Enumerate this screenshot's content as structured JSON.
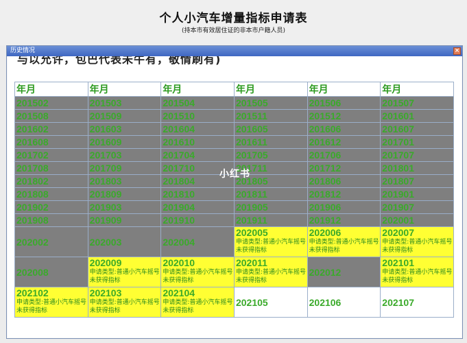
{
  "header": {
    "title": "个人小汽车增量指标申请表",
    "subtitle": "(持本市有效居住证的非本市户籍人员)"
  },
  "window": {
    "title": "历史情况",
    "close_glyph": "×",
    "clipped_text": "与以允许，包巴代表未牛有，敬情刷有)"
  },
  "table": {
    "header": [
      "年月",
      "年月",
      "年月",
      "年月",
      "年月",
      "年月"
    ],
    "grey_rows": [
      [
        "201502",
        "201503",
        "201504",
        "201505",
        "201506",
        "201507"
      ],
      [
        "201508",
        "201509",
        "201510",
        "201511",
        "201512",
        "201601"
      ],
      [
        "201602",
        "201603",
        "201604",
        "201605",
        "201606",
        "201607"
      ],
      [
        "201608",
        "201609",
        "201610",
        "201611",
        "201612",
        "201701"
      ],
      [
        "201702",
        "201703",
        "201704",
        "201705",
        "201706",
        "201707"
      ],
      [
        "201708",
        "201709",
        "201710",
        "201711",
        "201712",
        "201801"
      ],
      [
        "201802",
        "201803",
        "201804",
        "201805",
        "201806",
        "201807"
      ],
      [
        "201808",
        "201809",
        "201810",
        "201811",
        "201812",
        "201901"
      ],
      [
        "201902",
        "201903",
        "201904",
        "201905",
        "201906",
        "201907"
      ],
      [
        "201908",
        "201909",
        "201910",
        "201911",
        "201912",
        "202001"
      ]
    ],
    "tall_rows": [
      [
        {
          "month": "202002",
          "status": "gray",
          "note1": "",
          "note2": ""
        },
        {
          "month": "202003",
          "status": "gray",
          "note1": "",
          "note2": ""
        },
        {
          "month": "202004",
          "status": "gray",
          "note1": "",
          "note2": ""
        },
        {
          "month": "202005",
          "status": "yellow",
          "note1": "申请类型:普通小汽车摇号",
          "note2": "未获得指标"
        },
        {
          "month": "202006",
          "status": "yellow",
          "note1": "申请类型:普通小汽车摇号",
          "note2": "未获得指标"
        },
        {
          "month": "202007",
          "status": "yellow",
          "note1": "申请类型:普通小汽车摇号",
          "note2": "未获得指标"
        }
      ],
      [
        {
          "month": "202008",
          "status": "gray",
          "note1": "",
          "note2": ""
        },
        {
          "month": "202009",
          "status": "yellow",
          "note1": "申请类型:普通小汽车摇号",
          "note2": "未获得指标"
        },
        {
          "month": "202010",
          "status": "yellow",
          "note1": "申请类型:普通小汽车摇号",
          "note2": "未获得指标"
        },
        {
          "month": "202011",
          "status": "yellow",
          "note1": "申请类型:普通小汽车摇号",
          "note2": "未获得指标"
        },
        {
          "month": "202012",
          "status": "gray",
          "note1": "",
          "note2": ""
        },
        {
          "month": "202101",
          "status": "yellow",
          "note1": "申请类型:普通小汽车摇号",
          "note2": "未获得指标"
        }
      ],
      [
        {
          "month": "202102",
          "status": "yellow",
          "note1": "申请类型:普通小汽车摇号",
          "note2": "未获得指标"
        },
        {
          "month": "202103",
          "status": "yellow",
          "note1": "申请类型:普通小汽车摇号",
          "note2": "未获得指标"
        },
        {
          "month": "202104",
          "status": "yellow",
          "note1": "申请类型:普通小汽车摇号",
          "note2": "未获得指标"
        },
        {
          "month": "202105",
          "status": "white",
          "note1": "",
          "note2": ""
        },
        {
          "month": "202106",
          "status": "white",
          "note1": "",
          "note2": ""
        },
        {
          "month": "202107",
          "status": "white",
          "note1": "",
          "note2": ""
        }
      ]
    ]
  },
  "watermark": "小红书",
  "colors": {
    "gray_cell": "#7f7f7f",
    "yellow_cell": "#ffff33",
    "text_green": "#3aaa2a",
    "titlebar": "#4a72c8"
  }
}
